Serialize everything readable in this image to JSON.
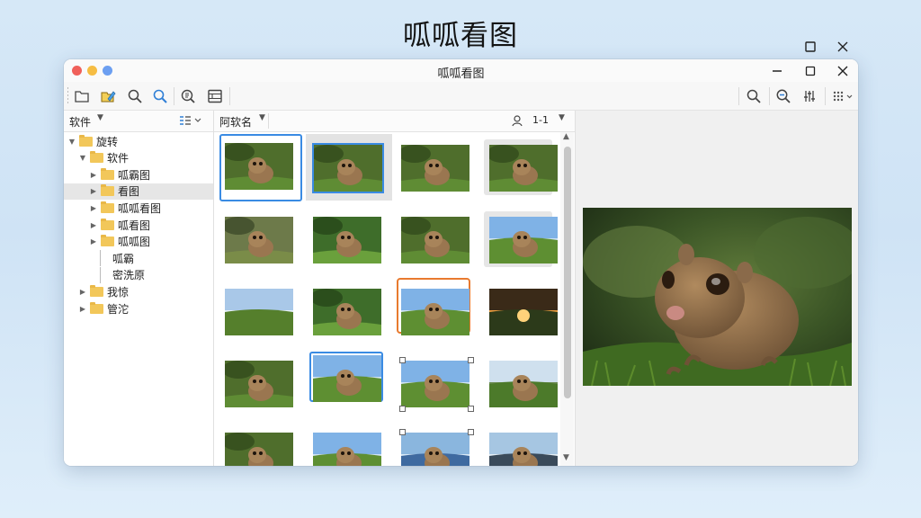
{
  "page_title": "呱呱看图",
  "window": {
    "title": "呱呱看图",
    "traffic_colors": [
      "#f0605a",
      "#f6bd43",
      "#6c9ff1"
    ]
  },
  "toolbar": {
    "left_icons": [
      "folder-icon",
      "edit-icon",
      "search-icon",
      "search-blue-icon",
      "zoom-doc-icon",
      "film-icon"
    ],
    "right_icons": [
      "magnifier-icon",
      "zoom-icon",
      "adjust-icon",
      "grid-menu-icon"
    ]
  },
  "sidebar": {
    "header_label": "软件",
    "tree": [
      {
        "label": "旋转",
        "level": 0,
        "expander": "▼",
        "selected": false
      },
      {
        "label": "软件",
        "level": 1,
        "expander": "▼",
        "selected": false
      },
      {
        "label": "呱霸图",
        "level": 2,
        "expander": "▶",
        "selected": false
      },
      {
        "label": "看图",
        "level": 2,
        "expander": "▶",
        "selected": true
      },
      {
        "label": "呱呱看图",
        "level": 2,
        "expander": "▶",
        "selected": false
      },
      {
        "label": "呱看图",
        "level": 2,
        "expander": "▶",
        "selected": false
      },
      {
        "label": "呱呱图",
        "level": 2,
        "expander": "▶",
        "selected": false
      },
      {
        "label": "呱霸",
        "level": 3,
        "expander": "",
        "selected": false,
        "folder": false
      },
      {
        "label": "密洗原",
        "level": 3,
        "expander": "",
        "selected": false,
        "folder": false
      },
      {
        "label": "我惊",
        "level": 1,
        "expander": "▶",
        "selected": false
      },
      {
        "label": "管沱",
        "level": 1,
        "expander": "▶",
        "selected": false
      }
    ]
  },
  "gallery": {
    "header_label": "阿软名",
    "sort_label": "1-1",
    "thumbnails": [
      {
        "scene": "grass",
        "selection": "blue"
      },
      {
        "scene": "grass",
        "selection": "blue-fill"
      },
      {
        "scene": "grass",
        "selection": "none"
      },
      {
        "scene": "grass",
        "selection": "frame"
      },
      {
        "scene": "zoom",
        "selection": "none"
      },
      {
        "scene": "leaves",
        "selection": "none"
      },
      {
        "scene": "grass",
        "selection": "none"
      },
      {
        "scene": "sky",
        "selection": "frame"
      },
      {
        "scene": "field",
        "selection": "none"
      },
      {
        "scene": "leaves",
        "selection": "none"
      },
      {
        "scene": "sky",
        "selection": "orange"
      },
      {
        "scene": "sunset",
        "selection": "none"
      },
      {
        "scene": "grass",
        "selection": "none"
      },
      {
        "scene": "sky",
        "selection": "blue-thick"
      },
      {
        "scene": "sky",
        "selection": "handles"
      },
      {
        "scene": "forest",
        "selection": "none"
      },
      {
        "scene": "grass",
        "selection": "none"
      },
      {
        "scene": "sky",
        "selection": "none"
      },
      {
        "scene": "sea",
        "selection": "handles-top"
      },
      {
        "scene": "lake",
        "selection": "none"
      }
    ]
  },
  "preview": {
    "scene": "close-up"
  }
}
